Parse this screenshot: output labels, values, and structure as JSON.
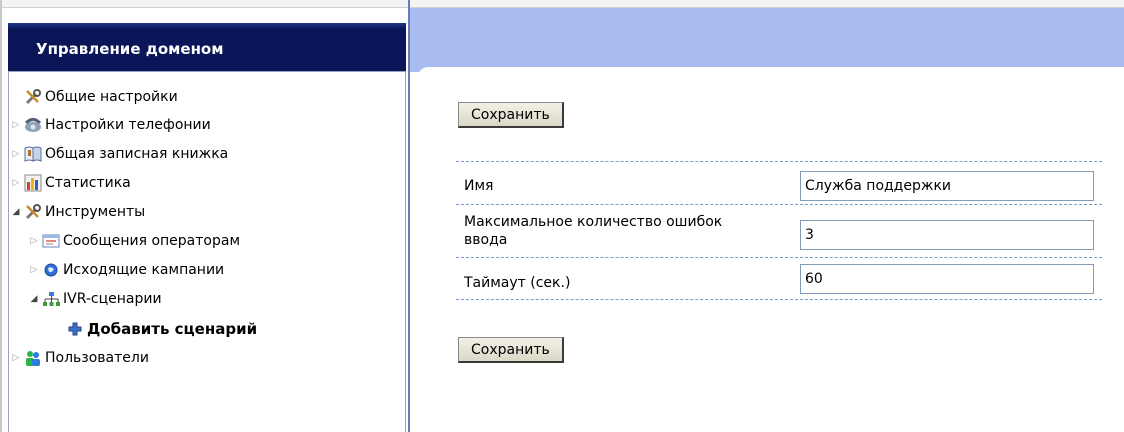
{
  "sidebar": {
    "title": "Управление доменом",
    "items": [
      {
        "label": "Общие настройки",
        "icon": "tools-icon"
      },
      {
        "label": "Настройки телефонии",
        "icon": "telephone-icon"
      },
      {
        "label": "Общая записная книжка",
        "icon": "address-book-icon"
      },
      {
        "label": "Статистика",
        "icon": "chart-icon"
      },
      {
        "label": "Инструменты",
        "icon": "tools-icon"
      },
      {
        "label": "Сообщения операторам",
        "icon": "message-icon"
      },
      {
        "label": "Исходящие кампании",
        "icon": "globe-icon"
      },
      {
        "label": "IVR-сценарии",
        "icon": "network-icon"
      },
      {
        "label": "Добавить сценарий",
        "icon": "plus-icon"
      },
      {
        "label": "Пользователи",
        "icon": "users-icon"
      }
    ]
  },
  "form": {
    "save_label": "Сохранить",
    "fields": [
      {
        "label": "Имя",
        "value": "Служба поддержки"
      },
      {
        "label": "Максимальное количество ошибок ввода",
        "value": "3"
      },
      {
        "label": "Таймаут (сек.)",
        "value": "60"
      }
    ]
  },
  "colors": {
    "header_bg": "#0a1657",
    "band_bg": "#a8bcf0",
    "divider": "#6a7cb8",
    "dashed_line": "#7d9ad0"
  }
}
